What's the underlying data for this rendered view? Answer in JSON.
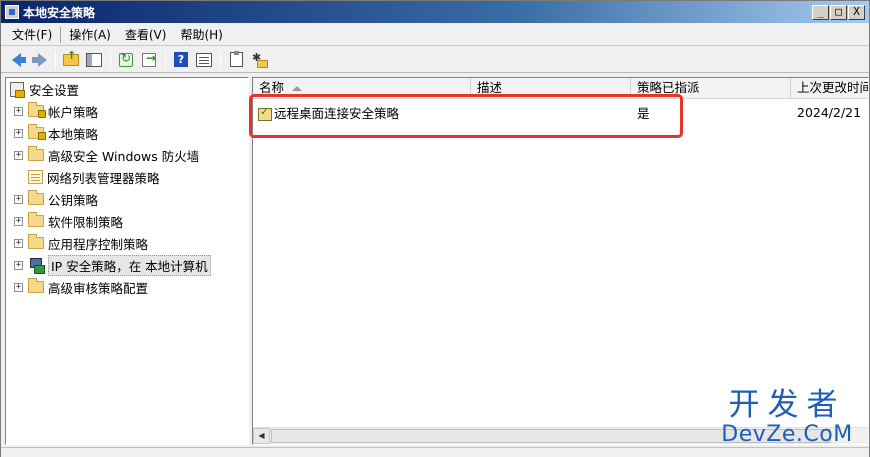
{
  "window": {
    "title": "本地安全策略",
    "controls": {
      "minimize": "_",
      "maximize": "□",
      "close": "X"
    }
  },
  "menu": {
    "items": [
      "文件(F)",
      "操作(A)",
      "查看(V)",
      "帮助(H)"
    ]
  },
  "toolbar": {
    "icons": [
      "back-arrow-icon",
      "forward-arrow-icon",
      "folder-up-icon",
      "show-hide-tree-icon",
      "refresh-icon",
      "export-list-icon",
      "help-icon",
      "properties-icon",
      "clipboard-icon",
      "new-item-icon"
    ]
  },
  "tree": {
    "root": "安全设置",
    "items": [
      {
        "label": "帐户策略",
        "icon": "folder-lock-icon",
        "expandable": true
      },
      {
        "label": "本地策略",
        "icon": "folder-lock-icon",
        "expandable": true
      },
      {
        "label": "高级安全 Windows 防火墙",
        "icon": "folder-icon",
        "expandable": true
      },
      {
        "label": "网络列表管理器策略",
        "icon": "folder-list-icon",
        "expandable": false
      },
      {
        "label": "公钥策略",
        "icon": "folder-icon",
        "expandable": true
      },
      {
        "label": "软件限制策略",
        "icon": "folder-icon",
        "expandable": true
      },
      {
        "label": "应用程序控制策略",
        "icon": "folder-icon",
        "expandable": true
      },
      {
        "label": "IP 安全策略，在 本地计算机",
        "icon": "ipsec-icon",
        "expandable": true,
        "selected": true
      },
      {
        "label": "高级审核策略配置",
        "icon": "folder-icon",
        "expandable": true
      }
    ]
  },
  "list": {
    "columns": [
      "名称",
      "描述",
      "策略已指派",
      "上次更改时间"
    ],
    "rows": [
      {
        "name": "远程桌面连接安全策略",
        "description": "",
        "assigned": "是",
        "modified": "2024/2/21"
      }
    ]
  },
  "annotation": {
    "color": "#e8322c"
  },
  "watermark": {
    "line1": "开发者",
    "line2": "DevZe.CoM"
  }
}
